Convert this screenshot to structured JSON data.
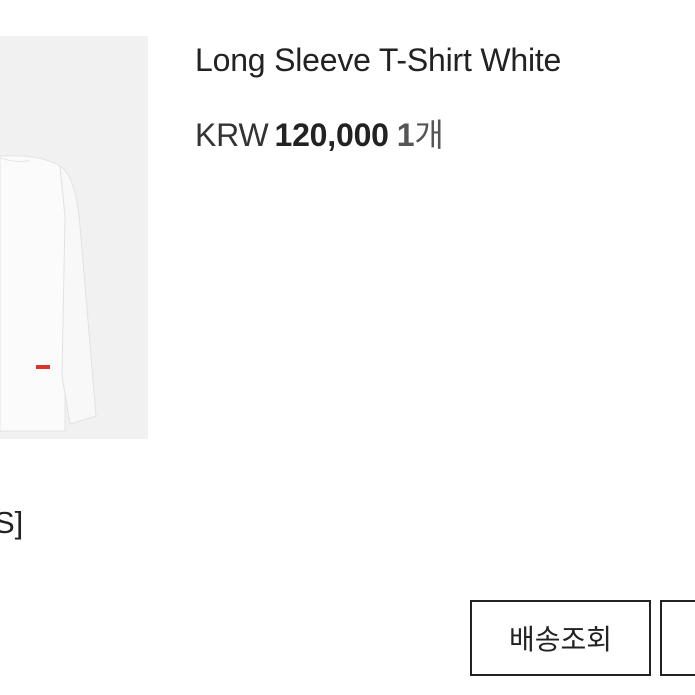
{
  "product": {
    "name": "Long Sleeve T-Shirt White",
    "currency": "KRW",
    "price": "120,000",
    "quantity": "1",
    "quantity_unit": "개"
  },
  "option_text": "S]",
  "buttons": {
    "tracking_label": "배송조회",
    "next_label": ""
  },
  "colors": {
    "thumbnail_bg": "#f1f1f1",
    "label_tag": "#d9342b",
    "border": "#222222"
  }
}
